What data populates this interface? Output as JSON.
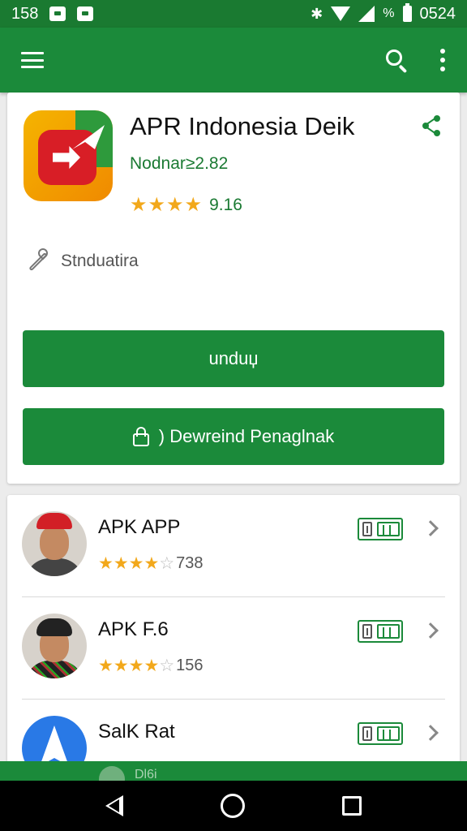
{
  "status_bar": {
    "time_left": "158",
    "percent_label": "%",
    "clock": "0524"
  },
  "app_bar": {
    "menu_icon": "hamburger-menu-icon",
    "search_icon": "search-icon",
    "more_icon": "more-vertical-icon"
  },
  "app_detail": {
    "title": "APR Indonesia Deik",
    "developer": "Nodnar≥2.82",
    "stars": "★★★★",
    "rating_count": "9.16",
    "category": "Stnduatira",
    "install_button": "unduџ",
    "secondary_button": ") Dewreind Penaglnak",
    "colors": {
      "primary": "#1b8a3a",
      "star": "#f2a81b"
    }
  },
  "related_apps": [
    {
      "title": "APK APP",
      "stars_filled": "★★★★",
      "stars_empty": "☆",
      "count": "738",
      "avatar": "person-red-hat"
    },
    {
      "title": "APK F.6",
      "stars_filled": "★★★★",
      "stars_empty": "☆",
      "count": "156",
      "avatar": "person-batik"
    },
    {
      "title": "SalK Rat",
      "stars_filled": "",
      "stars_empty": "",
      "count": "",
      "avatar": "blue-arrow-logo"
    }
  ],
  "bottom_strip": {
    "peek_text": "Dl6i"
  }
}
